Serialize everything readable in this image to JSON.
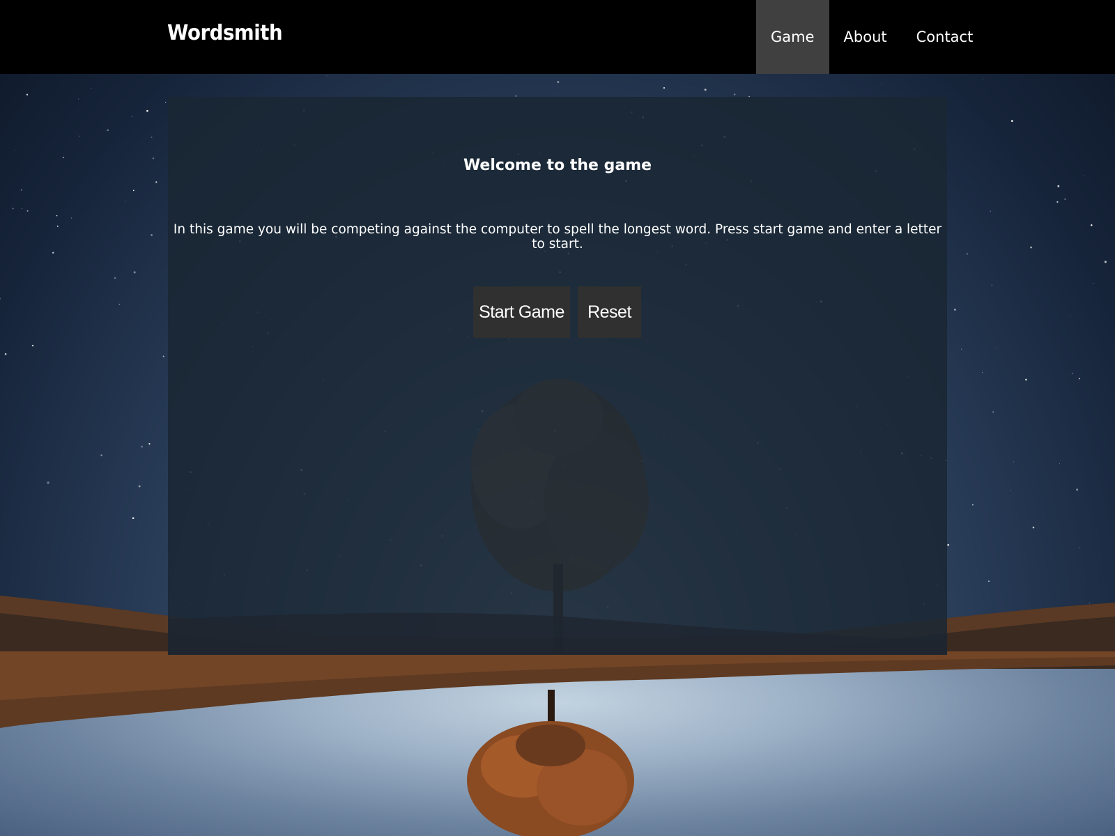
{
  "nav": {
    "brand": "Wordsmith",
    "items": [
      {
        "label": "Game",
        "active": true
      },
      {
        "label": "About",
        "active": false
      },
      {
        "label": "Contact",
        "active": false
      }
    ],
    "background_color": "#000000",
    "active_color": "#404040"
  },
  "main": {
    "heading": "Welcome to the game",
    "intro": "In this game you will be competing against the computer to spell the longest word. Press start game and enter a letter to start.",
    "buttons": {
      "start_label": "Start Game",
      "reset_label": "Reset"
    }
  },
  "background": {
    "scene": "night sky with lone tree reflected in lake"
  }
}
